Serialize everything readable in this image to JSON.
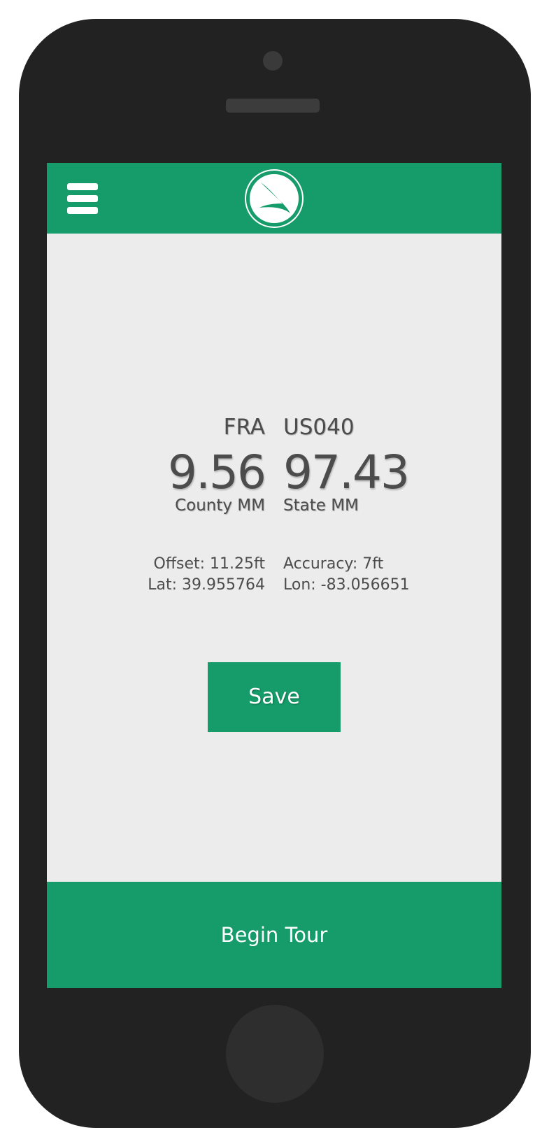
{
  "header": {
    "menu_icon": "hamburger-menu-icon",
    "logo_icon": "swoosh-logo-icon",
    "brand_color": "#169c6a"
  },
  "readout": {
    "county": "FRA",
    "route": "US040",
    "county_mm_value": "9.56",
    "state_mm_value": "97.43",
    "county_mm_label": "County MM",
    "state_mm_label": "State MM",
    "offset": "Offset: 11.25ft",
    "accuracy": "Accuracy: 7ft",
    "lat": "Lat: 39.955764",
    "lon": "Lon: -83.056651"
  },
  "actions": {
    "save_label": "Save",
    "begin_tour_label": "Begin Tour"
  },
  "colors": {
    "screen_background": "#ececec",
    "text": "#4c4c4c",
    "phone_body": "#222222"
  }
}
